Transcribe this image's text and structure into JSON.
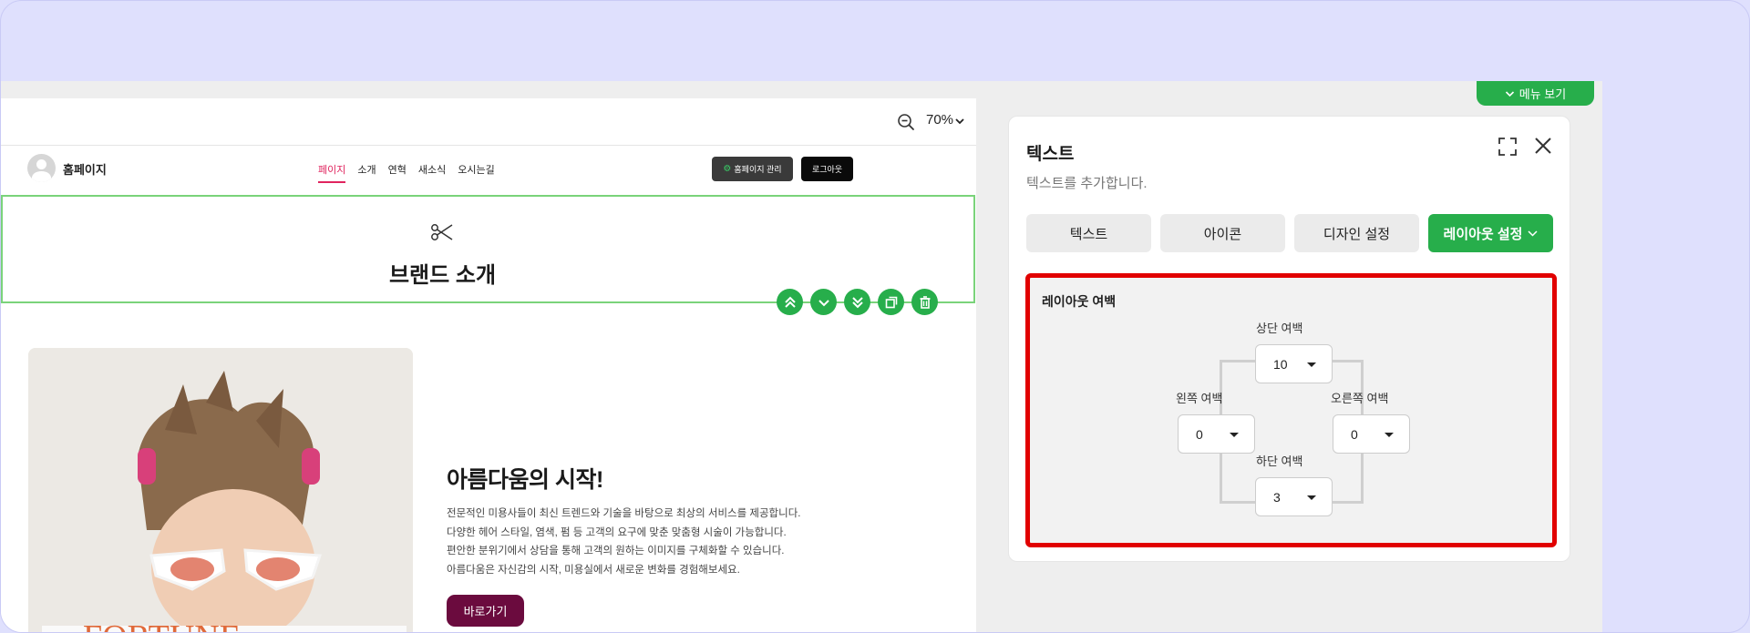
{
  "canvas": {
    "zoom_label": "70%",
    "site": {
      "brand": "홈페이지",
      "nav": [
        "페이지",
        "소개",
        "연혁",
        "새소식",
        "오시는길"
      ],
      "admin_button": "홈페이지 관리",
      "logout_button": "로그아웃"
    },
    "section_title": "브랜드 소개",
    "hero": {
      "title": "아름다움의 시작!",
      "body": [
        "전문적인 미용사들이 최신 트렌드와 기술을 바탕으로 최상의 서비스를 제공합니다.",
        "다양한 헤어 스타일, 염색, 펌 등 고객의 요구에 맞춘 맞춤형 시술이 가능합니다.",
        "편안한 분위기에서 상담을 통해 고객의 원하는 이미지를 구체화할 수 있습니다.",
        "아름다움은 자신감의 시작, 미용실에서 새로운 변화를 경험해보세요."
      ],
      "button": "바로가기",
      "image_text": "FORTUNE"
    }
  },
  "menu_toggle": "메뉴 보기",
  "panel": {
    "title": "텍스트",
    "subtitle": "텍스트를 추가합니다.",
    "tabs": [
      "텍스트",
      "아이콘",
      "디자인 설정",
      "레이아웃 설정"
    ],
    "layout": {
      "label": "레이아웃 여백",
      "top_label": "상단 여백",
      "top_value": "10",
      "left_label": "왼쪽 여백",
      "left_value": "0",
      "right_label": "오른쪽 여백",
      "right_value": "0",
      "bottom_label": "하단 여백",
      "bottom_value": "3"
    }
  },
  "colors": {
    "accent_green": "#27ae4b",
    "highlight_red": "#e10000",
    "nav_active": "#e0245e",
    "hero_button": "#6b0b3e",
    "background": "#dfe0fd"
  }
}
